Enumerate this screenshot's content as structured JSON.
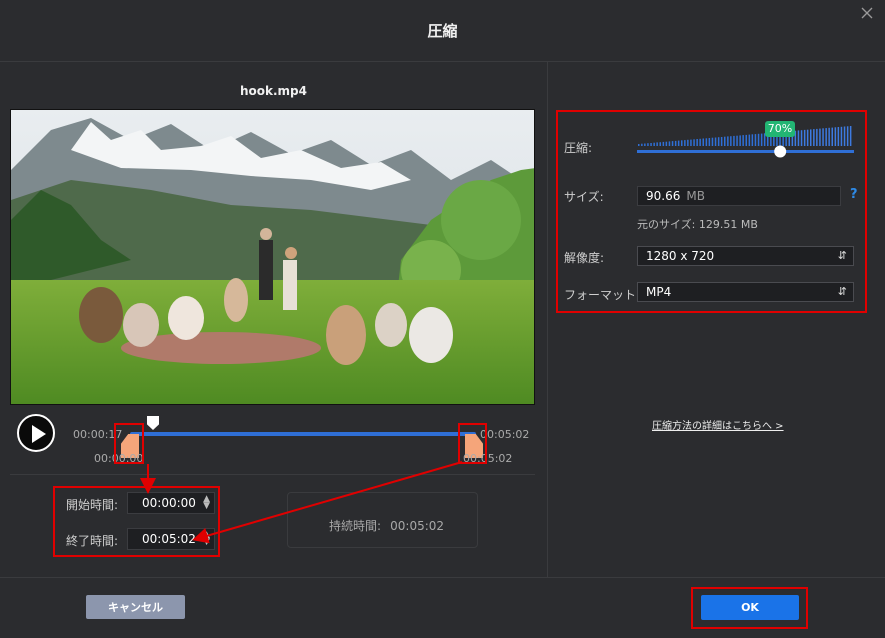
{
  "window": {
    "title": "圧縮",
    "close_icon": "close-icon"
  },
  "preview": {
    "filename": "hook.mp4",
    "current_time": "00:00:17",
    "end_time": "00:05:02",
    "start_marker": "00:00:00",
    "end_marker": "00:05:02",
    "playhead_fraction": 0.06
  },
  "trim": {
    "start_label": "開始時間:",
    "start_value": "00:00:00",
    "end_label": "終了時間:",
    "end_value": "00:05:02",
    "duration_label": "持続時間:",
    "duration_value": "00:05:02"
  },
  "compress": {
    "label": "圧縮:",
    "percent": 70,
    "percent_text": "70%",
    "size_label": "サイズ:",
    "size_value": "90.66",
    "size_unit": "MB",
    "original_size": "元のサイズ: 129.51 MB",
    "resolution_label": "解像度:",
    "resolution_value": "1280 x 720",
    "format_label": "フォーマット:",
    "format_value": "MP4",
    "details_link": "圧縮方法の詳細はこちらへ >"
  },
  "footer": {
    "cancel_label": "キャンセル",
    "ok_label": "OK"
  },
  "colors": {
    "accent": "#1a73e8",
    "highlight": "#e00000",
    "handle": "#f5a57a",
    "badge": "#22b573"
  }
}
